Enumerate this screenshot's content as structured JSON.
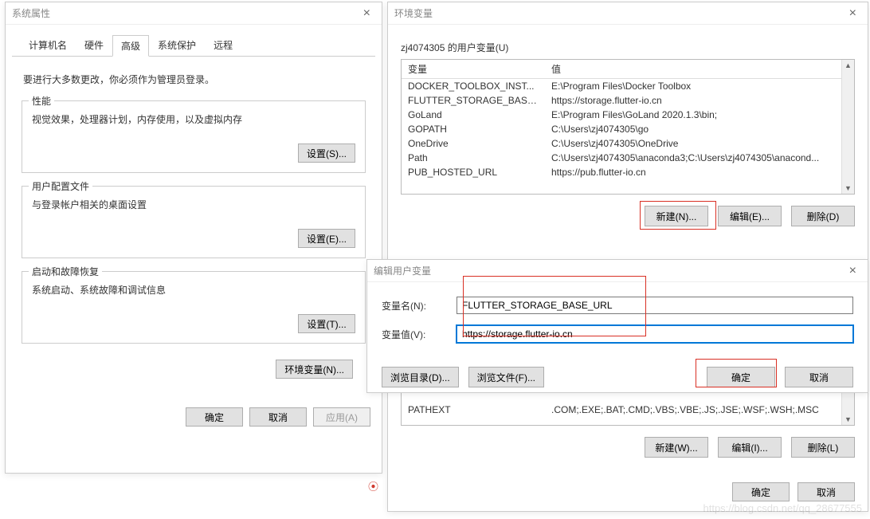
{
  "sysprops": {
    "title": "系统属性",
    "tabs": [
      "计算机名",
      "硬件",
      "高级",
      "系统保护",
      "远程"
    ],
    "active_tab": 2,
    "note": "要进行大多数更改，你必须作为管理员登录。",
    "groups": {
      "perf": {
        "title": "性能",
        "desc": "视觉效果，处理器计划，内存使用，以及虚拟内存",
        "btn": "设置(S)..."
      },
      "profile": {
        "title": "用户配置文件",
        "desc": "与登录帐户相关的桌面设置",
        "btn": "设置(E)..."
      },
      "startup": {
        "title": "启动和故障恢复",
        "desc": "系统启动、系统故障和调试信息",
        "btn": "设置(T)..."
      }
    },
    "envvars_btn": "环境变量(N)...",
    "ok": "确定",
    "cancel": "取消",
    "apply": "应用(A)"
  },
  "envvars": {
    "title": "环境变量",
    "user_section_title": "zj4074305 的用户变量(U)",
    "cols": {
      "var": "变量",
      "val": "值"
    },
    "user_rows": [
      {
        "var": "DOCKER_TOOLBOX_INST...",
        "val": "E:\\Program Files\\Docker Toolbox"
      },
      {
        "var": "FLUTTER_STORAGE_BASE_...",
        "val": "https://storage.flutter-io.cn"
      },
      {
        "var": "GoLand",
        "val": "E:\\Program Files\\GoLand 2020.1.3\\bin;"
      },
      {
        "var": "GOPATH",
        "val": "C:\\Users\\zj4074305\\go"
      },
      {
        "var": "OneDrive",
        "val": "C:\\Users\\zj4074305\\OneDrive"
      },
      {
        "var": "Path",
        "val": "C:\\Users\\zj4074305\\anaconda3;C:\\Users\\zj4074305\\anacond..."
      },
      {
        "var": "PUB_HOSTED_URL",
        "val": "https://pub.flutter-io.cn"
      }
    ],
    "user_btns": {
      "new": "新建(N)...",
      "edit": "编辑(E)...",
      "del": "删除(D)"
    },
    "sys_rows": [
      {
        "var": "PATHEXT",
        "val": ".COM;.EXE;.BAT;.CMD;.VBS;.VBE;.JS;.JSE;.WSF;.WSH;.MSC"
      }
    ],
    "sys_btns": {
      "new": "新建(W)...",
      "edit": "编辑(I)...",
      "del": "删除(L)"
    },
    "ok": "确定",
    "cancel": "取消"
  },
  "editvar": {
    "title": "编辑用户变量",
    "name_label": "变量名(N):",
    "name_value": "FLUTTER_STORAGE_BASE_URL",
    "value_label": "变量值(V):",
    "value_value": "https://storage.flutter-io.cn",
    "browse_dir": "浏览目录(D)...",
    "browse_file": "浏览文件(F)...",
    "ok": "确定",
    "cancel": "取消"
  },
  "watermark": "https://blog.csdn.net/qq_28677555",
  "wm_icon": "⦿"
}
